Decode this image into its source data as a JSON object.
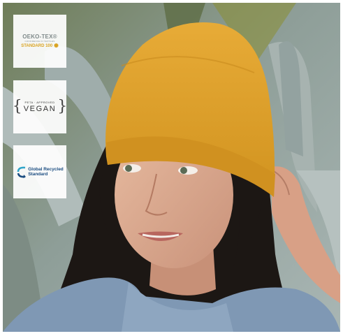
{
  "badges": {
    "oeko": {
      "title": "OEKO-TEX®",
      "subtitle": "CONFIDENCE IN TEXTILES",
      "standard": "STANDARD 100",
      "icon": "sun-logo-icon",
      "accent_color": "#d9a321"
    },
    "vegan": {
      "peta": "PETA · APPROVED",
      "label": "VEGAN"
    },
    "grs": {
      "line1": "Global Recycled",
      "line2": "Standard",
      "icon": "recycle-arcs-icon",
      "accent_color": "#1a4c80"
    }
  },
  "photo": {
    "beanie_color": "#e0a02c",
    "hoodie_color": "#7f98b4"
  }
}
